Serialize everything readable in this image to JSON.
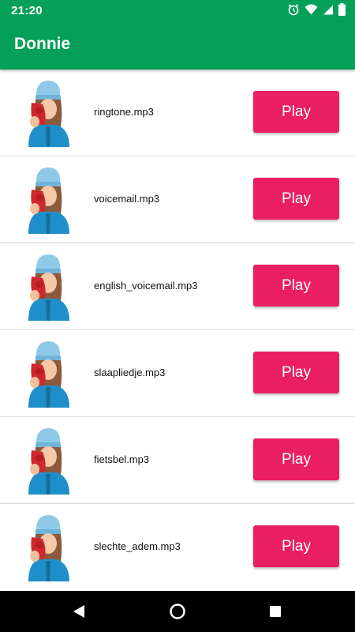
{
  "status_bar": {
    "time": "21:20",
    "icons": [
      "alarm-icon",
      "wifi-icon",
      "signal-icon",
      "battery-icon"
    ]
  },
  "app_bar": {
    "title": "Donnie"
  },
  "items": [
    {
      "filename": "ringtone.mp3",
      "button_label": "Play"
    },
    {
      "filename": "voicemail.mp3",
      "button_label": "Play"
    },
    {
      "filename": "english_voicemail.mp3",
      "button_label": "Play"
    },
    {
      "filename": "slaapliedje.mp3",
      "button_label": "Play"
    },
    {
      "filename": "fietsbel.mp3",
      "button_label": "Play"
    },
    {
      "filename": "slechte_adem.mp3",
      "button_label": "Play"
    }
  ],
  "nav_bar": {
    "buttons": [
      "back-icon",
      "home-icon",
      "recents-icon"
    ]
  },
  "colors": {
    "primary": "#04a05a",
    "accent": "#e91e63",
    "navbar": "#000000"
  }
}
